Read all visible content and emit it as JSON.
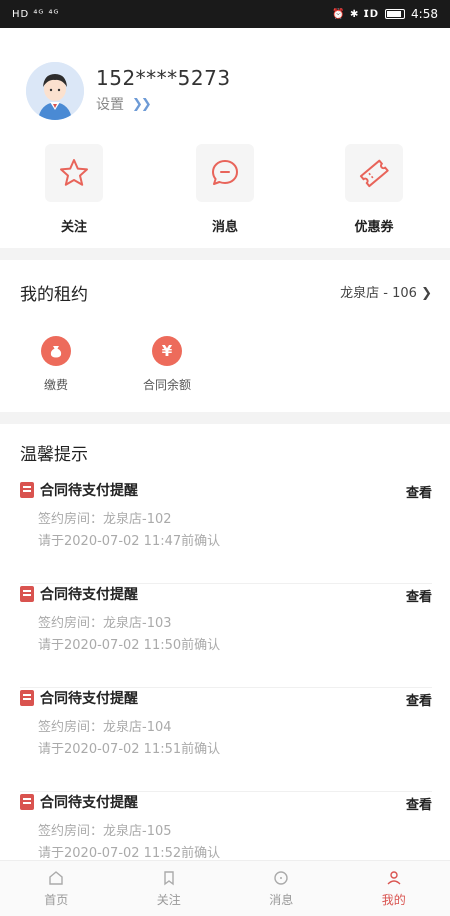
{
  "status_bar": {
    "time": "4:58",
    "left": "HD ⁴ᴳ ⁴ᴳ",
    "right": "⏰ ✱ 𝗜𝗗 "
  },
  "profile": {
    "phone": "152****5273",
    "settings_label": "设置"
  },
  "quick_actions": [
    {
      "label": "关注",
      "icon": "star-icon"
    },
    {
      "label": "消息",
      "icon": "chat-icon"
    },
    {
      "label": "优惠券",
      "icon": "ticket-icon"
    }
  ],
  "rent": {
    "title": "我的租约",
    "store": "龙泉店 - 106",
    "items": [
      {
        "label": "缴费",
        "icon": "money-bag-icon"
      },
      {
        "label": "合同余额",
        "icon": "yen-icon"
      }
    ]
  },
  "tips": {
    "title": "温馨提示",
    "items": [
      {
        "title": "合同待支付提醒",
        "room": "签约房间：龙泉店-102",
        "deadline": "请于2020-07-02 11:47前确认",
        "action": "查看"
      },
      {
        "title": "合同待支付提醒",
        "room": "签约房间：龙泉店-103",
        "deadline": "请于2020-07-02 11:50前确认",
        "action": "查看"
      },
      {
        "title": "合同待支付提醒",
        "room": "签约房间：龙泉店-104",
        "deadline": "请于2020-07-02 11:51前确认",
        "action": "查看"
      },
      {
        "title": "合同待支付提醒",
        "room": "签约房间：龙泉店-105",
        "deadline": "请于2020-07-02 11:52前确认",
        "action": "查看"
      }
    ]
  },
  "tabbar": [
    {
      "label": "首页"
    },
    {
      "label": "关注"
    },
    {
      "label": "消息"
    },
    {
      "label": "我的"
    }
  ],
  "colors": {
    "accent": "#d9534f",
    "circle": "#ed6b5b",
    "link": "#6e9bd6"
  }
}
